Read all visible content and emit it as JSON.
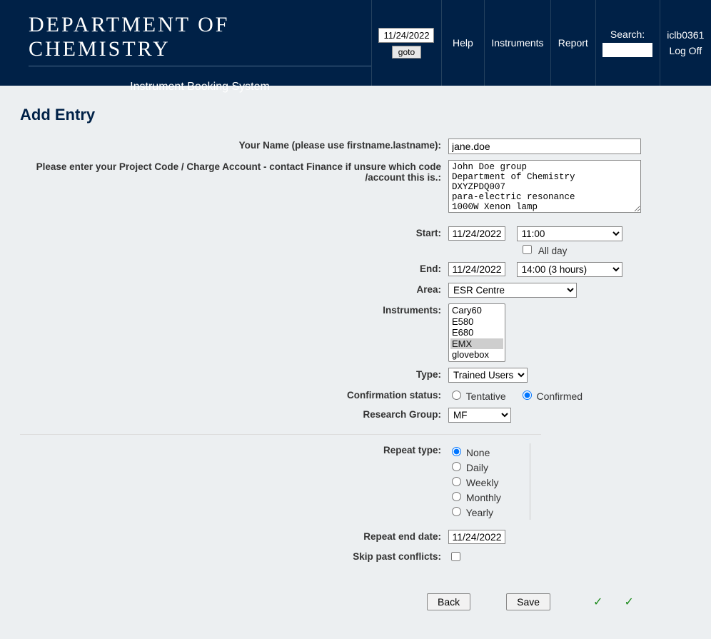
{
  "header": {
    "dept_name": "DEPARTMENT OF CHEMISTRY",
    "subtitle": "Instrument Booking System",
    "date": "11/24/2022",
    "goto": "goto",
    "help": "Help",
    "instruments": "Instruments",
    "report": "Report",
    "search_label": "Search:",
    "user": "iclb0361",
    "logoff": "Log Off"
  },
  "page": {
    "title": "Add Entry"
  },
  "form": {
    "name_label": "Your Name (please use firstname.lastname):",
    "name_value": "jane.doe",
    "project_label": "Please enter your Project Code / Charge Account - contact Finance if unsure which code /account this is.:",
    "project_value": "John Doe group\nDepartment of Chemistry\nDXYZPDQ007\npara-electric resonance\n1000W Xenon lamp",
    "start_label": "Start:",
    "start_date": "11/24/2022",
    "start_time": "11:00",
    "allday_label": "All day",
    "end_label": "End:",
    "end_date": "11/24/2022",
    "end_time": "14:00  (3 hours)",
    "area_label": "Area:",
    "area_value": "ESR Centre",
    "instruments_label": "Instruments:",
    "instruments_options": [
      "Cary60",
      "E580",
      "E680",
      "EMX",
      "glovebox"
    ],
    "instruments_selected": "EMX",
    "type_label": "Type:",
    "type_value": "Trained Users",
    "confirm_label": "Confirmation status:",
    "confirm_tentative": "Tentative",
    "confirm_confirmed": "Confirmed",
    "confirm_selected": "Confirmed",
    "rg_label": "Research Group:",
    "rg_value": "MF",
    "repeat_label": "Repeat type:",
    "repeat_options": [
      "None",
      "Daily",
      "Weekly",
      "Monthly",
      "Yearly"
    ],
    "repeat_selected": "None",
    "repeat_end_label": "Repeat end date:",
    "repeat_end_value": "11/24/2022",
    "skip_label": "Skip past conflicts:"
  },
  "buttons": {
    "back": "Back",
    "save": "Save"
  }
}
